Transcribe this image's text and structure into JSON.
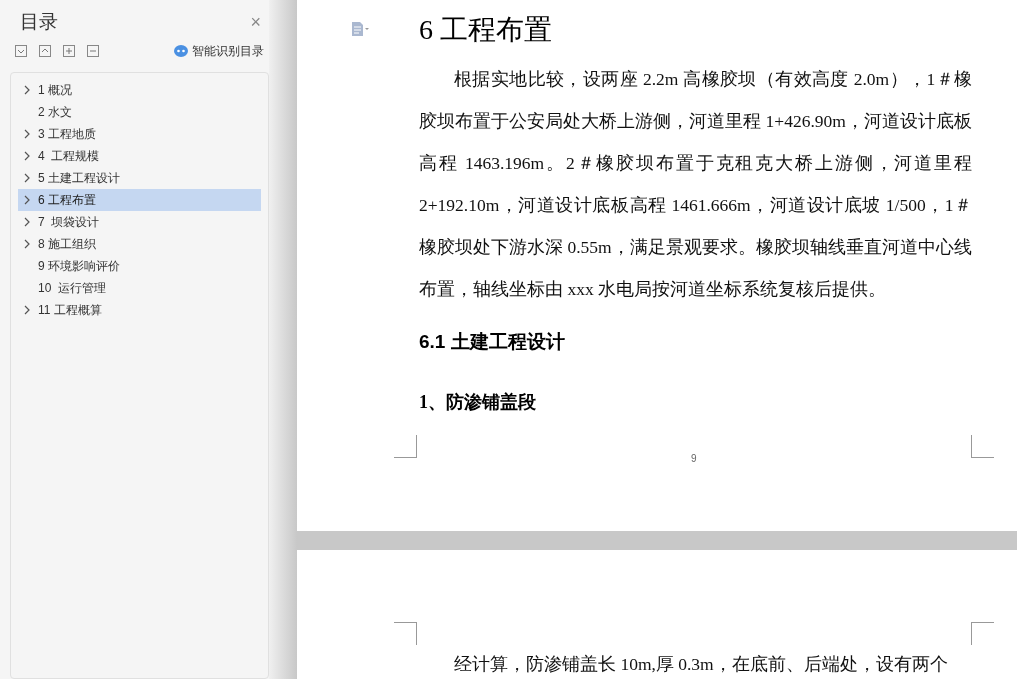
{
  "sidebar": {
    "title": "目录",
    "close": "×",
    "smart_toc": "智能识别目录",
    "items": [
      {
        "label": "1 概况",
        "has_children": true,
        "selected": false
      },
      {
        "label": "2 水文",
        "has_children": false,
        "selected": false
      },
      {
        "label": "3 工程地质",
        "has_children": true,
        "selected": false
      },
      {
        "label": "4  工程规模",
        "has_children": true,
        "selected": false
      },
      {
        "label": "5 土建工程设计",
        "has_children": true,
        "selected": false
      },
      {
        "label": "6 工程布置",
        "has_children": true,
        "selected": true
      },
      {
        "label": "7  坝袋设计",
        "has_children": true,
        "selected": false
      },
      {
        "label": "8 施工组织",
        "has_children": true,
        "selected": false
      },
      {
        "label": "9 环境影响评价",
        "has_children": false,
        "selected": false
      },
      {
        "label": "10  运行管理",
        "has_children": false,
        "selected": false
      },
      {
        "label": "11 工程概算",
        "has_children": true,
        "selected": false
      }
    ]
  },
  "document": {
    "heading": "6 工程布置",
    "paragraph": "根据实地比较，设两座 2.2m 高橡胶坝（有效高度 2.0m），1＃橡胶坝布置于公安局处大桥上游侧，河道里程 1+426.90m，河道设计底板高程 1463.196m。2＃橡胶坝布置于克租克大桥上游侧，河道里程 2+192.10m，河道设计底板高程 1461.666m，河道设计底坡 1/500，1＃橡胶坝处下游水深 0.55m，满足景观要求。橡胶坝轴线垂直河道中心线布置，轴线坐标由 xxx 水电局按河道坐标系统复核后提供。",
    "subheading": "6.1 土建工程设计",
    "section": "1、防渗铺盖段",
    "page_number": "9",
    "next_page_text": "经计算，防渗铺盖长 10m,厚 0.3m，在底前、后端处，设有两个"
  }
}
